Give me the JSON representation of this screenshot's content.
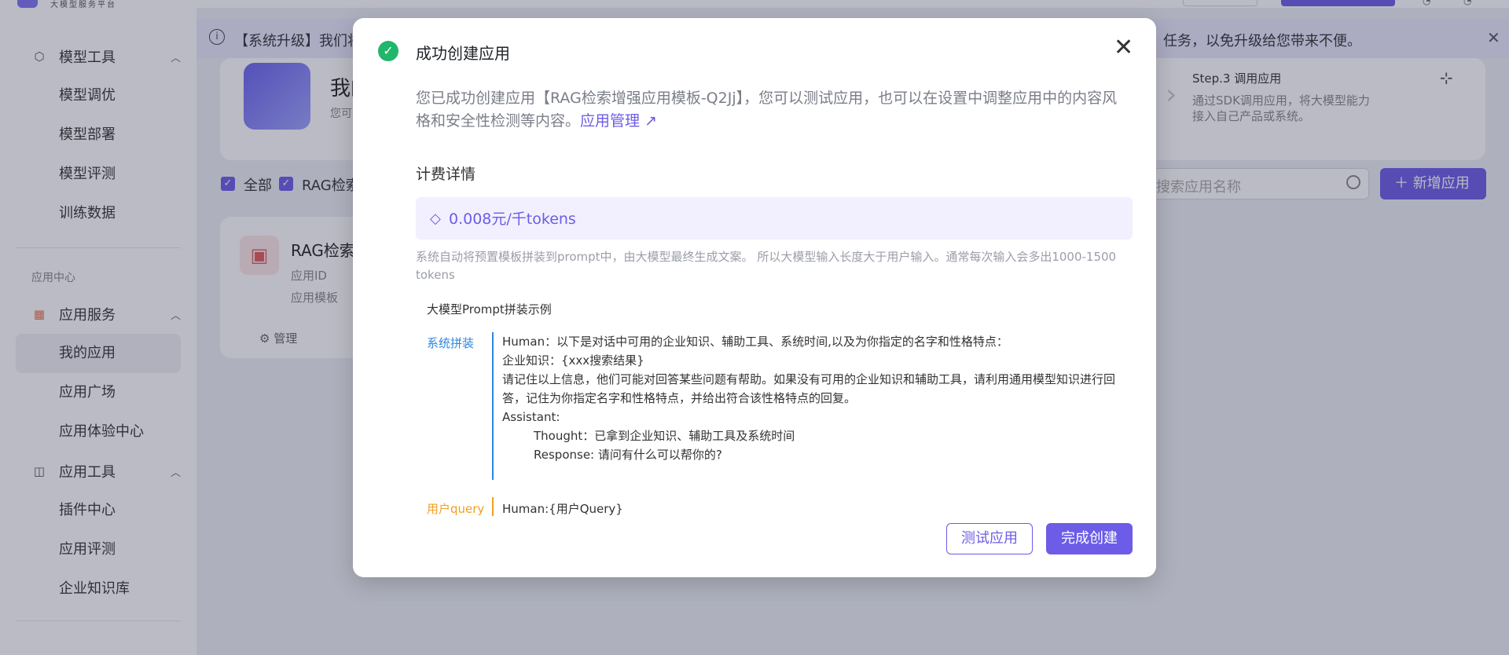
{
  "header": {
    "logo_subtitle": "大模型服务平台"
  },
  "sidebar": {
    "groups": [
      {
        "label": "模型工具",
        "items": [
          "模型调优",
          "模型部署",
          "模型评测",
          "训练数据"
        ]
      },
      {
        "label": "应用服务",
        "items": [
          "我的应用",
          "应用广场",
          "应用体验中心"
        ]
      },
      {
        "label": "应用工具",
        "items": [
          "插件中心",
          "应用评测",
          "企业知识库"
        ]
      }
    ],
    "section_label": "应用中心",
    "active_item": "我的应用"
  },
  "notice": {
    "text_left": "【系统升级】我们将",
    "text_right": "任务，以免升级给您带来不便。"
  },
  "hero": {
    "title": "我的",
    "subtitle": "您可",
    "step_title": "Step.3 调用应用",
    "step_desc": "通过SDK调用应用，将大模型能力接入自己产品或系统。"
  },
  "filters": {
    "all_label": "全部",
    "rag_label": "RAG检索"
  },
  "search": {
    "placeholder": "搜索应用名称"
  },
  "add_button": "新增应用",
  "app_card": {
    "title": "RAG检索",
    "meta1": "应用ID",
    "meta2": "应用模板",
    "manage": "管理"
  },
  "modal": {
    "title": "成功创建应用",
    "desc": "您已成功创建应用【RAG检索增强应用模板-Q2Jj】，您可以测试应用，也可以在设置中调整应用中的内容风格和安全性检测等内容。",
    "link": "应用管理 ↗",
    "section_title": "计费详情",
    "price": "0.008元/千tokens",
    "note": "系统自动将预置模板拼装到prompt中，由大模型最终生成文案。 所以大模型输入长度大于用户输入。通常每次输入会多出1000-1500 tokens",
    "example_title": "大模型Prompt拼装示例",
    "sys_label": "系统拼装",
    "sys_lines": [
      "Human：以下是对话中可用的企业知识、辅助工具、系统时间,以及为你指定的名字和性格特点：",
      "企业知识：{xxx搜索结果}",
      "请记住以上信息，他们可能对回答某些问题有帮助。如果没有可用的企业知识和辅助工具，请利用通用模型知识进行回答，记住为你指定名字和性格特点，并给出符合该性格特点的回复。",
      "Assistant:",
      "Thought：已拿到企业知识、辅助工具及系统时间",
      "Response: 请问有什么可以帮你的?"
    ],
    "query_label": "用户query",
    "query_text": "Human:{用户Query}",
    "test_button": "测试应用",
    "finish_button": "完成创建"
  },
  "colors": {
    "accent": "#6c5ce7",
    "success": "#21b66a",
    "system": "#2e86de",
    "query": "#f0a020"
  }
}
